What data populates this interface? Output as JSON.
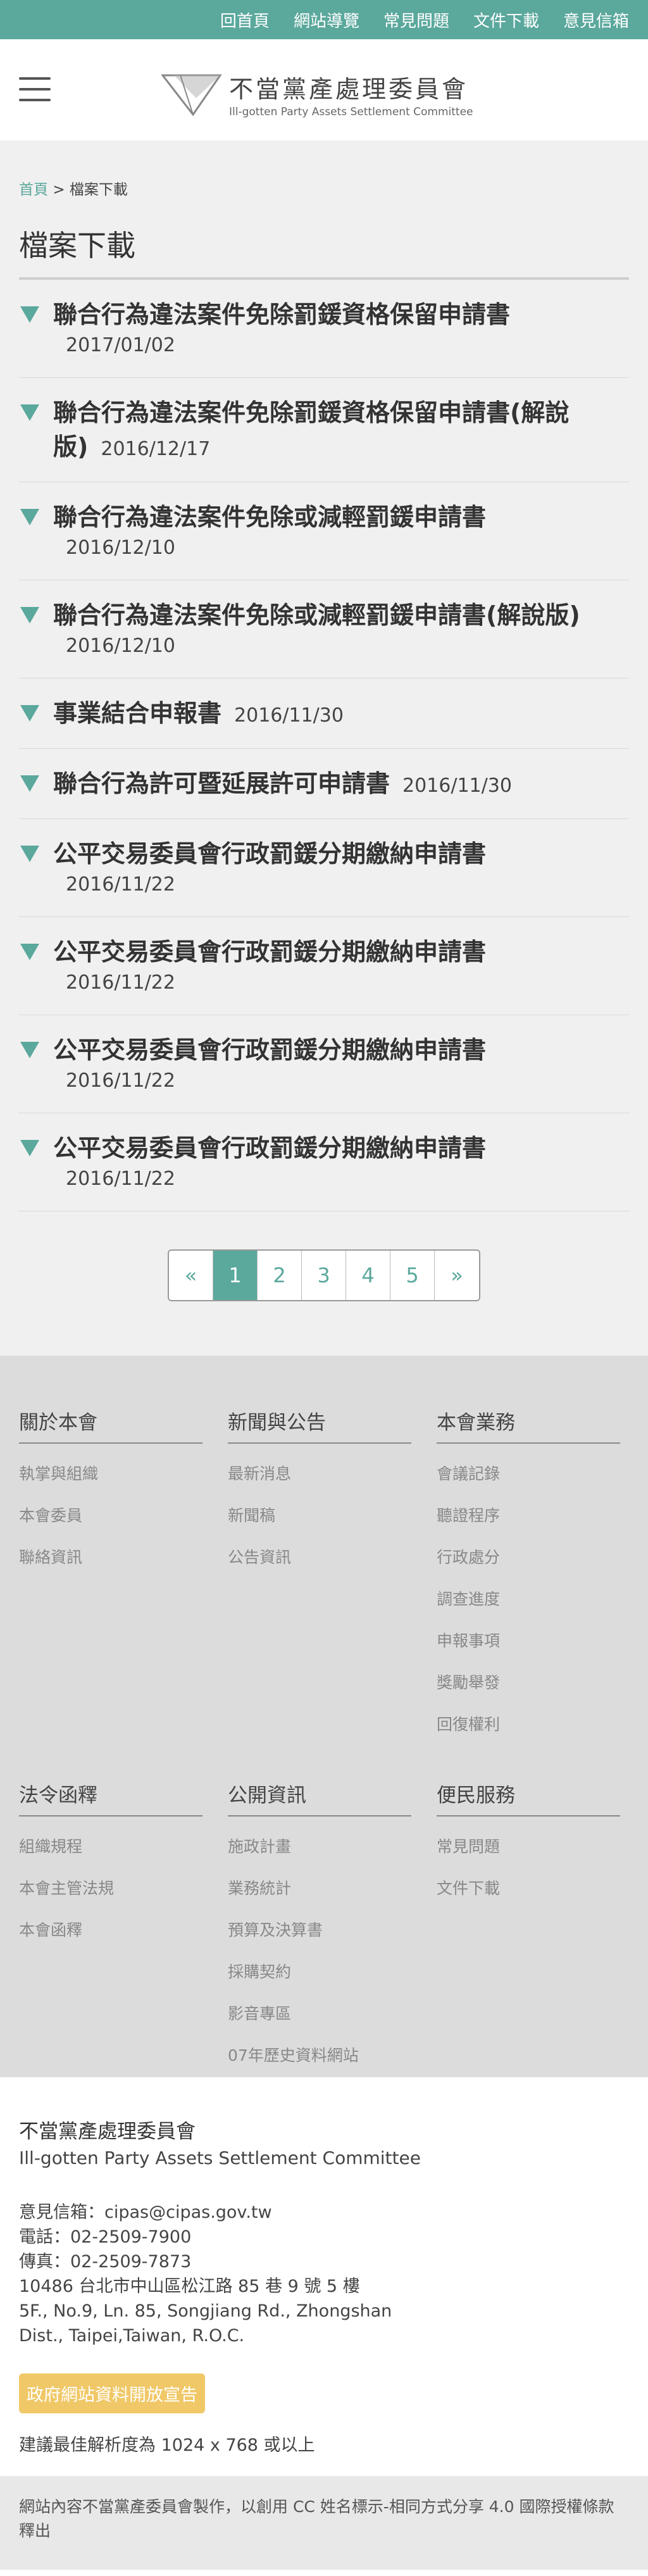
{
  "topnav": [
    "回首頁",
    "網站導覽",
    "常見問題",
    "文件下載",
    "意見信箱"
  ],
  "logo": {
    "name_zh": "不當黨產處理委員會",
    "name_en": "Ill-gotten Party Assets Settlement Committee"
  },
  "breadcrumb": {
    "home": "首頁",
    "separator": ">",
    "current": "檔案下載"
  },
  "page_title": "檔案下載",
  "documents": [
    {
      "name": "聯合行為違法案件免除罰鍰資格保留申請書",
      "date": "2017/01/02",
      "date_on_new_line": true
    },
    {
      "name": "聯合行為違法案件免除罰鍰資格保留申請書(解說版)",
      "date": "2016/12/17",
      "date_on_new_line": false
    },
    {
      "name": "聯合行為違法案件免除或減輕罰鍰申請書",
      "date": "2016/12/10",
      "date_on_new_line": true
    },
    {
      "name": "聯合行為違法案件免除或減輕罰鍰申請書(解說版)",
      "date": "2016/12/10",
      "date_on_new_line": true
    },
    {
      "name": "事業結合申報書",
      "date": "2016/11/30",
      "date_on_new_line": false
    },
    {
      "name": "聯合行為許可暨延展許可申請書",
      "date": "2016/11/30",
      "date_on_new_line": false
    },
    {
      "name": "公平交易委員會行政罰鍰分期繳納申請書",
      "date": "2016/11/22",
      "date_on_new_line": true
    },
    {
      "name": "公平交易委員會行政罰鍰分期繳納申請書",
      "date": "2016/11/22",
      "date_on_new_line": true
    },
    {
      "name": "公平交易委員會行政罰鍰分期繳納申請書",
      "date": "2016/11/22",
      "date_on_new_line": true
    },
    {
      "name": "公平交易委員會行政罰鍰分期繳納申請書",
      "date": "2016/11/22",
      "date_on_new_line": true
    }
  ],
  "pagination": {
    "prev": "«",
    "pages": [
      "1",
      "2",
      "3",
      "4",
      "5"
    ],
    "next": "»",
    "current": "1"
  },
  "footer_columns": [
    {
      "title": "關於本會",
      "links": [
        "執掌與組織",
        "本會委員",
        "聯絡資訊"
      ]
    },
    {
      "title": "新聞與公告",
      "links": [
        "最新消息",
        "新聞稿",
        "公告資訊"
      ]
    },
    {
      "title": "本會業務",
      "links": [
        "會議記錄",
        "聽證程序",
        "行政處分",
        "調查進度",
        "申報事項",
        "獎勵舉發",
        "回復權利"
      ]
    },
    {
      "title": "法令函釋",
      "links": [
        "組織規程",
        "本會主管法規",
        "本會函釋"
      ]
    },
    {
      "title": "公開資訊",
      "links": [
        "施政計畫",
        "業務統計",
        "預算及決算書",
        "採購契約",
        "影音專區",
        "07年歷史資料網站"
      ]
    },
    {
      "title": "便民服務",
      "links": [
        "常見問題",
        "文件下載"
      ]
    }
  ],
  "footer_info": {
    "org_zh": "不當黨產處理委員會",
    "org_en": "Ill-gotten Party Assets Settlement Committee",
    "email": "意見信箱：cipas@cipas.gov.tw",
    "phone": "電話：02-2509-7900",
    "fax": "傳真：02-2509-7873",
    "address_zh": "10486 台北市中山區松江路 85 巷 9 號 5 樓",
    "address_en_1": "5F., No.9, Ln. 85, Songjiang Rd., Zhongshan",
    "address_en_2": "Dist., Taipei,Taiwan, R.O.C.",
    "open_data_label": "政府網站資料開放宣告",
    "resolution": "建議最佳解析度為 1024 x 768 或以上"
  },
  "license_text": "網站內容不當黨產委員會製作，以創用 CC 姓名標示-相同方式分享 4.0 國際授權條款釋出",
  "colors": {
    "accent": "#5ba89d",
    "open_data": "#f0c867",
    "footer_bg": "#dcdcdc"
  }
}
